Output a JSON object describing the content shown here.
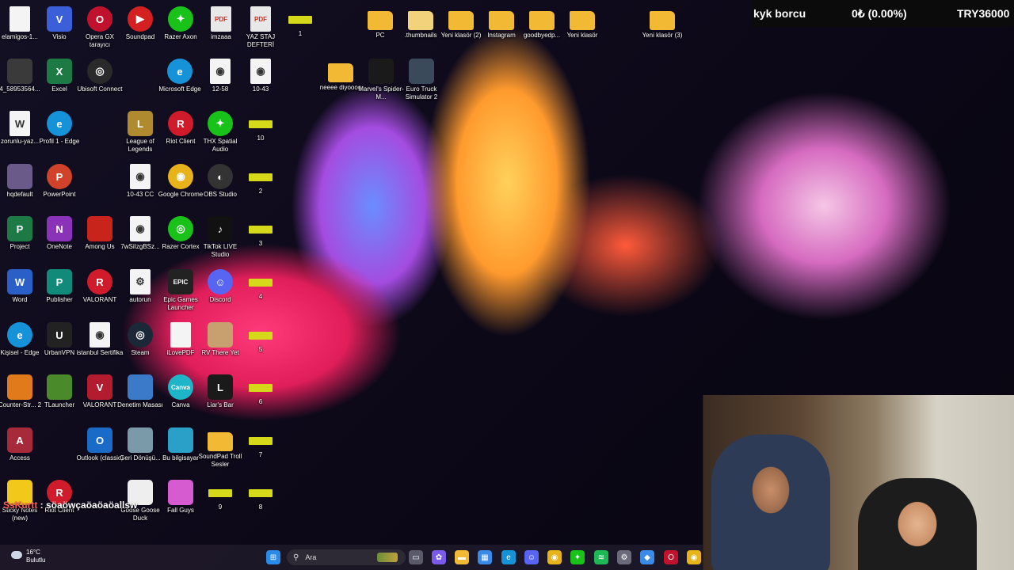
{
  "overlay": {
    "debt_label": "kyk borcu",
    "amount": "0₺ (0.00%)",
    "target": "TRY36000"
  },
  "chat": {
    "user": "SsKurtt",
    "message": " : söaöwçaöaöaöallsw"
  },
  "weather": {
    "temp": "16°C",
    "condition": "Bulutlu"
  },
  "search": {
    "placeholder": "Ara"
  },
  "desktop_icons": [
    {
      "label": "elamigos-1...",
      "glyph": "",
      "style": "doc",
      "color": "#f4f4f4"
    },
    {
      "label": "Visio",
      "glyph": "V",
      "style": "",
      "color": "#3a5fd8"
    },
    {
      "label": "Opera GX tarayıcı",
      "glyph": "O",
      "style": "round",
      "color": "#c0122c"
    },
    {
      "label": "Soundpad",
      "glyph": "▶",
      "style": "round",
      "color": "#d42020"
    },
    {
      "label": "Razer Axon",
      "glyph": "✦",
      "style": "round",
      "color": "#18c218"
    },
    {
      "label": "imzaaa",
      "glyph": "PDF",
      "style": "pdf",
      "color": "#e8e8e8"
    },
    {
      "label": "YAZ STAJ DEFTERİ",
      "glyph": "PDF",
      "style": "pdf",
      "color": "#e8e8e8"
    },
    {
      "label": "1",
      "glyph": "",
      "style": "tiny",
      "color": "#d6d81a"
    },
    {
      "label": "4_58953564...",
      "glyph": "",
      "style": "",
      "color": "#3a3a3a"
    },
    {
      "label": "Excel",
      "glyph": "X",
      "style": "",
      "color": "#1d7a45"
    },
    {
      "label": "Ubisoft Connect",
      "glyph": "◎",
      "style": "round",
      "color": "#2a2a2a"
    },
    {
      "label": "Microsoft Edge",
      "glyph": "e",
      "style": "round",
      "color": "#1592d8"
    },
    {
      "label": "12-58",
      "glyph": "◉",
      "style": "doc",
      "color": "#f4f4f4"
    },
    {
      "label": "10-43",
      "glyph": "◉",
      "style": "doc",
      "color": "#f4f4f4"
    },
    {
      "label": "zorunlu-yaz...",
      "glyph": "W",
      "style": "doc",
      "color": "#f4f4f4"
    },
    {
      "label": "Profil 1 - Edge",
      "glyph": "e",
      "style": "round",
      "color": "#1592d8"
    },
    {
      "label": "League of Legends",
      "glyph": "L",
      "style": "",
      "color": "#b08a2e"
    },
    {
      "label": "Riot Client",
      "glyph": "R",
      "style": "round",
      "color": "#d01c2a"
    },
    {
      "label": "THX Spatial Audio",
      "glyph": "✦",
      "style": "round",
      "color": "#18c218"
    },
    {
      "label": "10",
      "glyph": "",
      "style": "tiny",
      "color": "#d6d81a"
    },
    {
      "label": "hqdefault",
      "glyph": "",
      "style": "",
      "color": "#6a5a8a"
    },
    {
      "label": "PowerPoint",
      "glyph": "P",
      "style": "round",
      "color": "#d0432a"
    },
    {
      "label": "10-43 CC",
      "glyph": "◉",
      "style": "doc",
      "color": "#f4f4f4"
    },
    {
      "label": "Google Chrome",
      "glyph": "◉",
      "style": "round",
      "color": "#e8b21a"
    },
    {
      "label": "OBS Studio",
      "glyph": "◐",
      "style": "round",
      "color": "#333"
    },
    {
      "label": "2",
      "glyph": "",
      "style": "tiny",
      "color": "#d6d81a"
    },
    {
      "label": "Project",
      "glyph": "P",
      "style": "",
      "color": "#1d7a45"
    },
    {
      "label": "OneNote",
      "glyph": "N",
      "style": "",
      "color": "#8a32b8"
    },
    {
      "label": "Among Us",
      "glyph": "",
      "style": "",
      "color": "#c8241c"
    },
    {
      "label": "7wSiIzgBSz...",
      "glyph": "◉",
      "style": "doc",
      "color": "#f4f4f4"
    },
    {
      "label": "Razer Cortex",
      "glyph": "◎",
      "style": "round",
      "color": "#18c218"
    },
    {
      "label": "TikTok LIVE Studio",
      "glyph": "♪",
      "style": "",
      "color": "#111"
    },
    {
      "label": "3",
      "glyph": "",
      "style": "tiny",
      "color": "#d6d81a"
    },
    {
      "label": "Word",
      "glyph": "W",
      "style": "",
      "color": "#2a5fc8"
    },
    {
      "label": "Publisher",
      "glyph": "P",
      "style": "",
      "color": "#118a7a"
    },
    {
      "label": "VALORANT",
      "glyph": "R",
      "style": "round",
      "color": "#d01c2a"
    },
    {
      "label": "autorun",
      "glyph": "⚙",
      "style": "doc",
      "color": "#f4f4f4"
    },
    {
      "label": "Epic Games Launcher",
      "glyph": "EPIC",
      "style": "",
      "color": "#222"
    },
    {
      "label": "Discord",
      "glyph": "☺",
      "style": "round",
      "color": "#5865f2"
    },
    {
      "label": "4",
      "glyph": "",
      "style": "tiny",
      "color": "#d6d81a"
    },
    {
      "label": "Kişisel - Edge",
      "glyph": "e",
      "style": "round",
      "color": "#1592d8"
    },
    {
      "label": "UrbanVPN",
      "glyph": "U",
      "style": "",
      "color": "#222"
    },
    {
      "label": "istanbul Sertifika",
      "glyph": "◉",
      "style": "doc",
      "color": "#f4f4f4"
    },
    {
      "label": "Steam",
      "glyph": "◎",
      "style": "round",
      "color": "#1b2838"
    },
    {
      "label": "iLovePDF",
      "glyph": "",
      "style": "doc",
      "color": "#f4f4f4"
    },
    {
      "label": "RV There Yet",
      "glyph": "",
      "style": "",
      "color": "#c8a070"
    },
    {
      "label": "5",
      "glyph": "",
      "style": "tiny",
      "color": "#d6d81a"
    },
    {
      "label": "Counter-Str... 2",
      "glyph": "",
      "style": "",
      "color": "#e07a1a"
    },
    {
      "label": "TLauncher",
      "glyph": "",
      "style": "",
      "color": "#4a8a2a"
    },
    {
      "label": "VALORANT",
      "glyph": "V",
      "style": "",
      "color": "#b21c2e"
    },
    {
      "label": "Denetim Masası",
      "glyph": "",
      "style": "",
      "color": "#3a7ac8"
    },
    {
      "label": "Canva",
      "glyph": "Canva",
      "style": "round",
      "color": "#1fb5c8"
    },
    {
      "label": "Liar's Bar",
      "glyph": "L",
      "style": "",
      "color": "#1a1a1a"
    },
    {
      "label": "6",
      "glyph": "",
      "style": "tiny",
      "color": "#d6d81a"
    },
    {
      "label": "Access",
      "glyph": "A",
      "style": "",
      "color": "#a62a3a"
    },
    {
      "label": "Outlook (classic)",
      "glyph": "O",
      "style": "",
      "color": "#1a6ac8"
    },
    {
      "label": "Geri Dönüşü...",
      "glyph": "",
      "style": "",
      "color": "#7a9aaa"
    },
    {
      "label": "Bu bilgisayar",
      "glyph": "",
      "style": "",
      "color": "#2aa0c8"
    },
    {
      "label": "SoundPad Troll Sesler",
      "glyph": "",
      "style": "folder",
      "color": "#f2b934"
    },
    {
      "label": "7",
      "glyph": "",
      "style": "tiny",
      "color": "#d6d81a"
    },
    {
      "label": "Sticky Notes (new)",
      "glyph": "",
      "style": "",
      "color": "#f2c81a"
    },
    {
      "label": "Riot Client",
      "glyph": "R",
      "style": "round",
      "color": "#d01c2a"
    },
    {
      "label": "Goose Goose Duck",
      "glyph": "",
      "style": "",
      "color": "#eee"
    },
    {
      "label": "Fall Guys",
      "glyph": "",
      "style": "",
      "color": "#d65ad0"
    },
    {
      "label": "9",
      "glyph": "",
      "style": "tiny",
      "color": "#d6d81a"
    },
    {
      "label": "8",
      "glyph": "",
      "style": "tiny",
      "color": "#d6d81a"
    },
    {
      "label": "PC",
      "glyph": "",
      "style": "folder",
      "color": "#f2b934"
    },
    {
      "label": ".thumbnails",
      "glyph": "",
      "style": "folder",
      "color": "#f2d27a"
    },
    {
      "label": "Yeni klasör (2)",
      "glyph": "",
      "style": "folder",
      "color": "#f2b934"
    },
    {
      "label": "Instagram",
      "glyph": "",
      "style": "folder",
      "color": "#f2b934"
    },
    {
      "label": "goodbyedp...",
      "glyph": "",
      "style": "folder",
      "color": "#f2b934"
    },
    {
      "label": "Yeni klasör",
      "glyph": "",
      "style": "folder",
      "color": "#f2b934"
    },
    {
      "label": "Yeni klasör (3)",
      "glyph": "",
      "style": "folder",
      "color": "#f2b934"
    },
    {
      "label": "neeee diyoooo",
      "glyph": "",
      "style": "folder",
      "color": "#f2b934"
    },
    {
      "label": "Marvel's Spider-M...",
      "glyph": "",
      "style": "",
      "color": "#1a1a1a"
    },
    {
      "label": "Euro Truck Simulator 2",
      "glyph": "",
      "style": "",
      "color": "#3a4a5a"
    }
  ],
  "taskbar_icons": [
    {
      "name": "windows-start-icon",
      "color": "#2a8ae8",
      "glyph": "⊞"
    },
    {
      "name": "task-view-icon",
      "color": "#5a5a6a",
      "glyph": "▭"
    },
    {
      "name": "copilot-icon",
      "color": "#7a5ae8",
      "glyph": "✿"
    },
    {
      "name": "file-explorer-icon",
      "color": "#f2b934",
      "glyph": "▬"
    },
    {
      "name": "microsoft-store-icon",
      "color": "#3a8ae8",
      "glyph": "▦"
    },
    {
      "name": "edge-icon",
      "color": "#1592d8",
      "glyph": "e"
    },
    {
      "name": "discord-icon",
      "color": "#5865f2",
      "glyph": "☺"
    },
    {
      "name": "chrome-icon",
      "color": "#e8b21a",
      "glyph": "◉"
    },
    {
      "name": "razer-icon",
      "color": "#18c218",
      "glyph": "✦"
    },
    {
      "name": "spotify-icon",
      "color": "#1db954",
      "glyph": "≋"
    },
    {
      "name": "settings-icon",
      "color": "#6a6a7a",
      "glyph": "⚙"
    },
    {
      "name": "app-icon",
      "color": "#3a8ae8",
      "glyph": "◆"
    },
    {
      "name": "opera-gx-icon",
      "color": "#c0122c",
      "glyph": "O"
    },
    {
      "name": "chrome-active-icon",
      "color": "#e8b21a",
      "glyph": "◉"
    }
  ]
}
